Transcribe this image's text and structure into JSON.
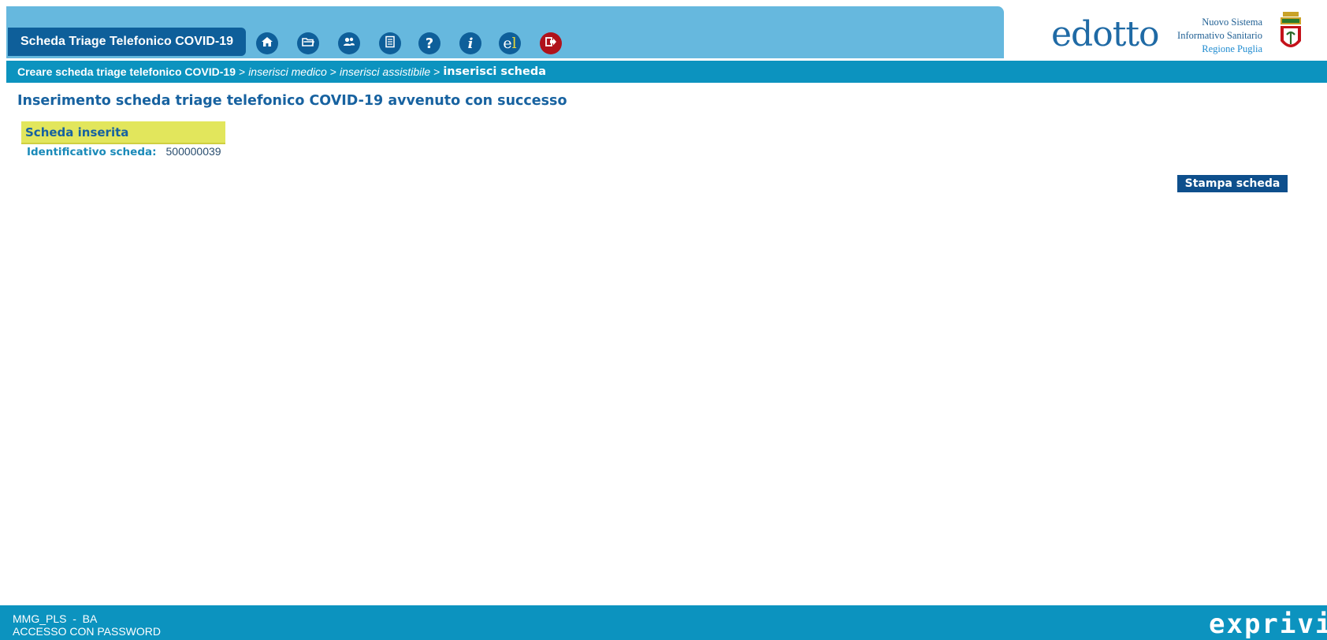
{
  "header": {
    "app_title": "Scheda Triage Telefonico COVID-19",
    "toolbar_icons": [
      "home-icon",
      "folder-icon",
      "users-icon",
      "document-icon",
      "help-icon",
      "info-icon",
      "elearning-icon",
      "exit-icon"
    ],
    "logo_text": "edotto",
    "nsis_line1": "Nuovo Sistema",
    "nsis_line2": "Informativo Sanitario",
    "nsis_line3": "Regione Puglia"
  },
  "breadcrumb": {
    "first": "Creare scheda triage telefonico COVID-19",
    "sep": ">",
    "step2": "inserisci medico",
    "step3": "inserisci assistibile",
    "current": "inserisci scheda"
  },
  "main": {
    "title": "Inserimento scheda triage telefonico COVID-19 avvenuto con successo",
    "panel_title": "Scheda inserita",
    "id_label": "Identificativo scheda:",
    "id_value": "500000039",
    "print_label": "Stampa scheda"
  },
  "footer": {
    "user_line": "MMG_PLS  -  BA",
    "access_line": "ACCESSO CON PASSWORD",
    "brand": "exprivia"
  },
  "colors": {
    "header_band": "#66b8de",
    "dark_blue": "#0e5f9a",
    "bar_teal": "#0c93bf",
    "panel_yellow": "#e2e65c",
    "exit_red": "#b0121b"
  }
}
